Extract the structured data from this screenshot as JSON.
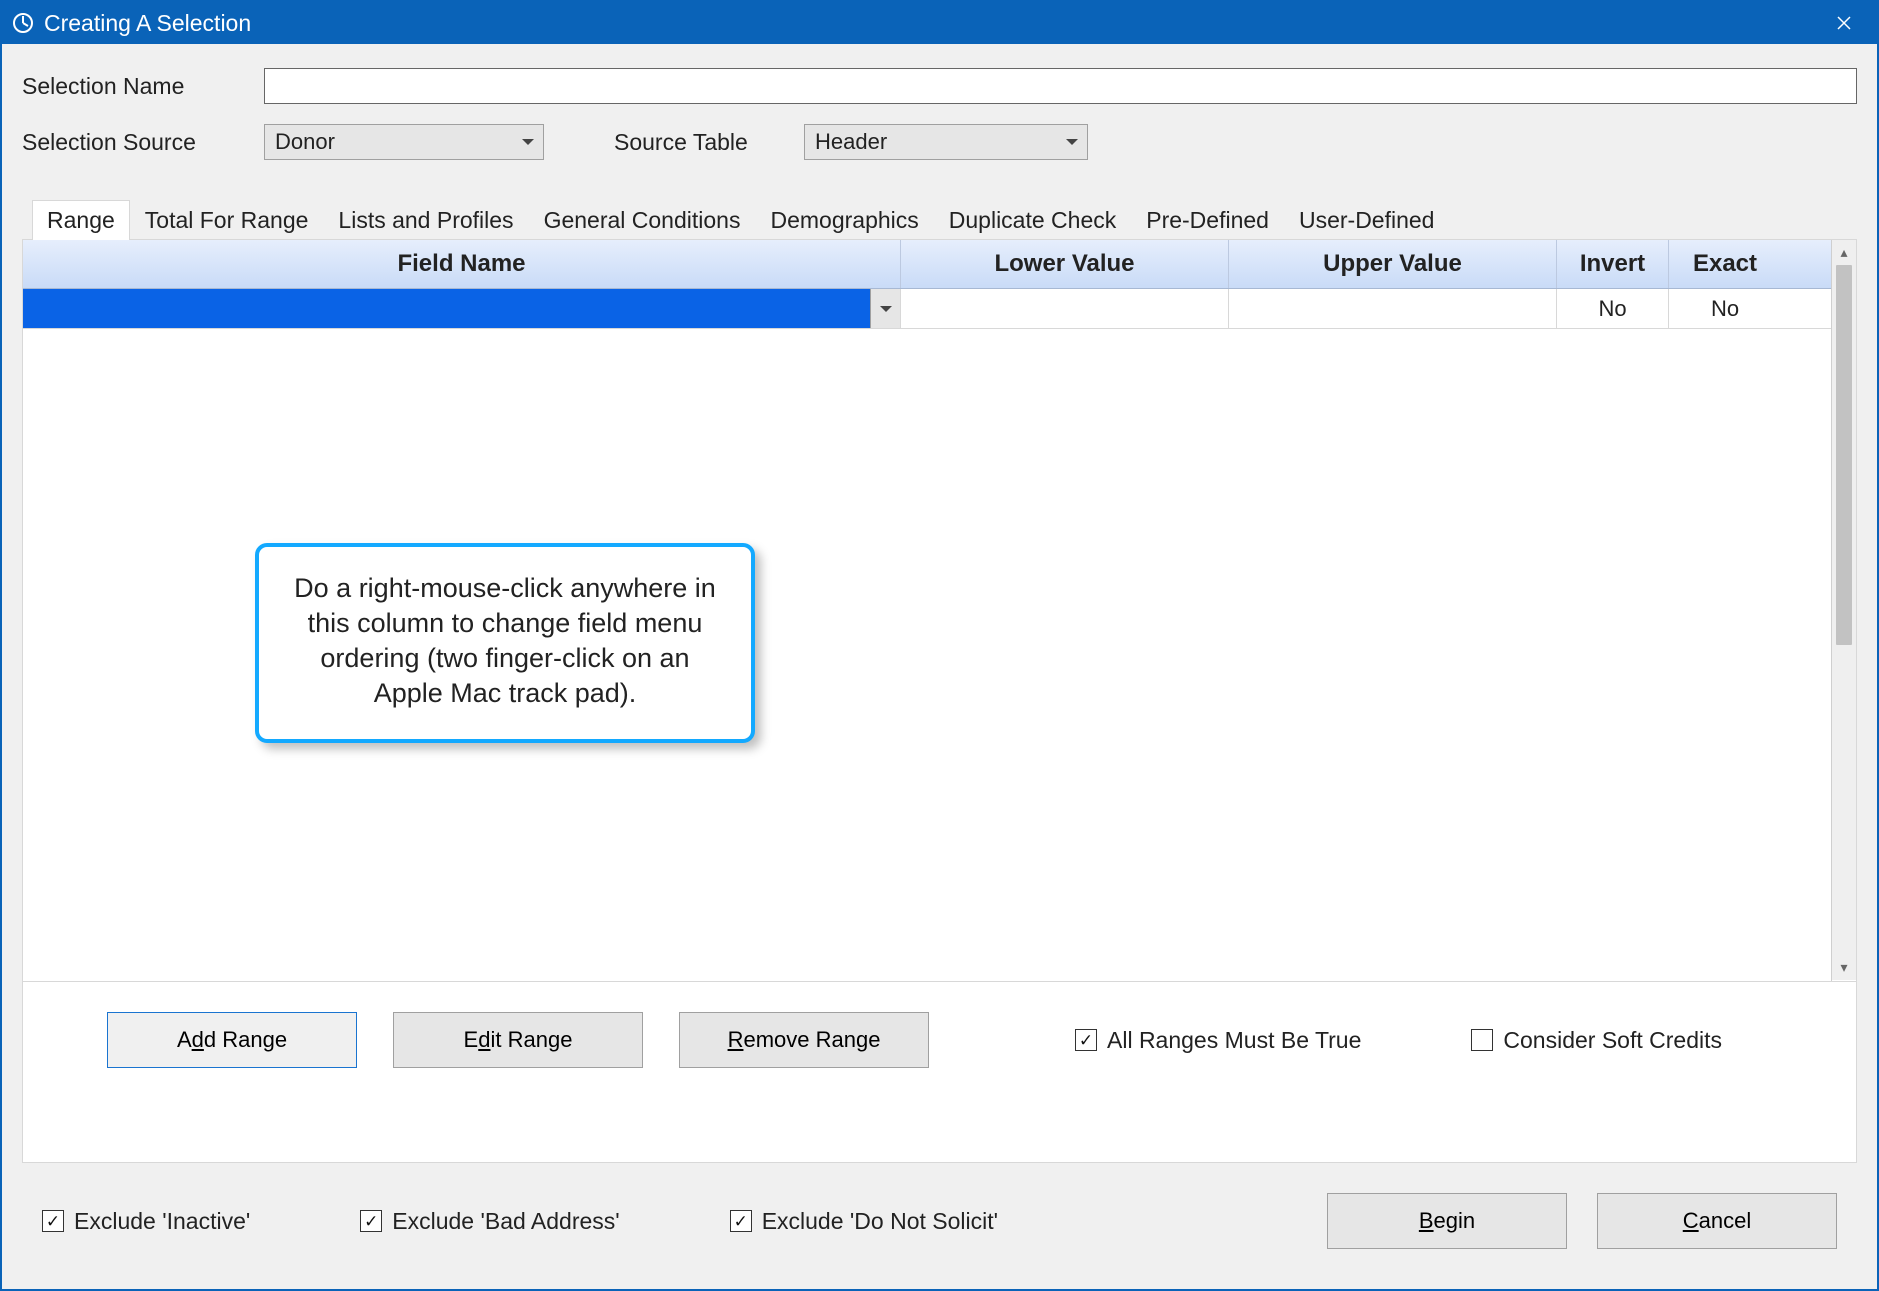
{
  "window": {
    "title": "Creating A Selection"
  },
  "form": {
    "selection_name_label": "Selection Name",
    "selection_name_value": "",
    "selection_source_label": "Selection Source",
    "selection_source_value": "Donor",
    "source_table_label": "Source Table",
    "source_table_value": "Header"
  },
  "tabs": [
    {
      "label": "Range",
      "active": true
    },
    {
      "label": "Total For Range",
      "active": false
    },
    {
      "label": "Lists and Profiles",
      "active": false
    },
    {
      "label": "General Conditions",
      "active": false
    },
    {
      "label": "Demographics",
      "active": false
    },
    {
      "label": "Duplicate Check",
      "active": false
    },
    {
      "label": "Pre-Defined",
      "active": false
    },
    {
      "label": "User-Defined",
      "active": false
    }
  ],
  "grid": {
    "columns": {
      "field": "Field Name",
      "lower": "Lower Value",
      "upper": "Upper Value",
      "invert": "Invert",
      "exact": "Exact"
    },
    "rows": [
      {
        "field": "",
        "lower": "",
        "upper": "",
        "invert": "No",
        "exact": "No"
      }
    ]
  },
  "callout": {
    "text": "Do a right-mouse-click anywhere in this column to change field menu ordering (two finger-click on an Apple Mac track pad)."
  },
  "range_actions": {
    "add_pre": "A",
    "add_ul": "d",
    "add_post": "d Range",
    "edit_pre": "E",
    "edit_ul": "d",
    "edit_post": "it Range",
    "remove_pre": "",
    "remove_ul": "R",
    "remove_post": "emove Range",
    "all_ranges": "All Ranges Must Be True",
    "soft_credits": "Consider Soft Credits"
  },
  "footer": {
    "exclude_inactive": "Exclude 'Inactive'",
    "exclude_bad_addr": "Exclude 'Bad Address'",
    "exclude_dns": "Exclude 'Do Not Solicit'",
    "begin_pre": "",
    "begin_ul": "B",
    "begin_post": "egin",
    "cancel_pre": "",
    "cancel_ul": "C",
    "cancel_post": "ancel"
  },
  "checks": {
    "all_ranges": true,
    "soft_credits": false,
    "exclude_inactive": true,
    "exclude_bad_addr": true,
    "exclude_dns": true
  }
}
